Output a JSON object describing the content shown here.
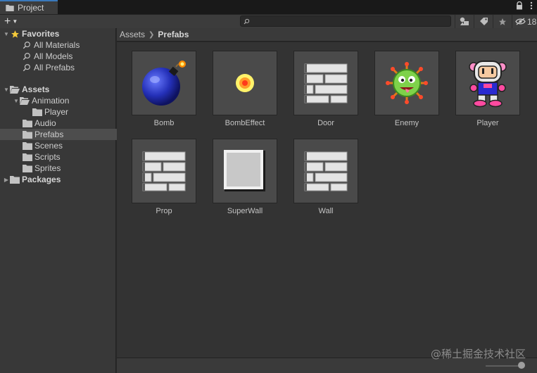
{
  "window": {
    "tab_label": "Project",
    "tab_icon": "folder-icon"
  },
  "tab_menu": {
    "lock_icon": "lock-icon",
    "more_icon": "kebab-menu-icon"
  },
  "toolbar": {
    "add_label": "+",
    "add_dropdown_icon": "chevron-down-icon",
    "search": {
      "value": "",
      "placeholder": ""
    },
    "filter_icons": [
      "filter-by-type-icon",
      "filter-by-label-icon",
      "favorite-star-icon"
    ],
    "hidden_packages_count": "18"
  },
  "sidebar": {
    "favorites": {
      "label": "Favorites",
      "items": [
        {
          "label": "All Materials"
        },
        {
          "label": "All Models"
        },
        {
          "label": "All Prefabs"
        }
      ]
    },
    "assets": {
      "label": "Assets",
      "items": [
        {
          "label": "Animation"
        },
        {
          "label": "Player"
        },
        {
          "label": "Audio"
        },
        {
          "label": "Prefabs",
          "selected": true
        },
        {
          "label": "Scenes"
        },
        {
          "label": "Scripts"
        },
        {
          "label": "Sprites"
        }
      ]
    },
    "packages": {
      "label": "Packages"
    }
  },
  "breadcrumb": {
    "root": "Assets",
    "current": "Prefabs"
  },
  "assets_grid": {
    "items": [
      {
        "label": "Bomb",
        "icon": "bomb-icon"
      },
      {
        "label": "BombEffect",
        "icon": "explosion-effect-icon"
      },
      {
        "label": "Door",
        "icon": "brick-wall-icon"
      },
      {
        "label": "Enemy",
        "icon": "enemy-virus-icon"
      },
      {
        "label": "Player",
        "icon": "bomberman-player-icon"
      },
      {
        "label": "Prop",
        "icon": "brick-wall-icon"
      },
      {
        "label": "SuperWall",
        "icon": "solid-block-icon"
      },
      {
        "label": "Wall",
        "icon": "brick-wall-icon"
      }
    ]
  },
  "footer": {
    "thumbnail_size_slider": 0.9
  },
  "watermark": "@稀土掘金技术社区",
  "colors": {
    "accent": "#3a79bb",
    "selection": "#4d4d4d",
    "star": "#f3c93a"
  }
}
